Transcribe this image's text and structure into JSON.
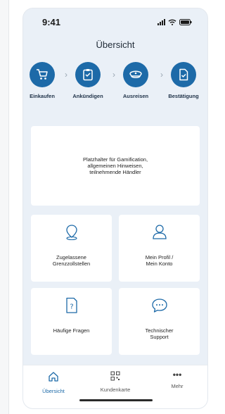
{
  "status_bar": {
    "time": "9:41"
  },
  "page": {
    "title": "Übersicht"
  },
  "steps": [
    {
      "label": "Einkaufen",
      "icon": "shopping-cart-icon"
    },
    {
      "label": "Ankündigen",
      "icon": "clipboard-icon"
    },
    {
      "label": "Ausreisen",
      "icon": "officer-cap-icon"
    },
    {
      "label": "Bestätigung",
      "icon": "document-check-icon"
    }
  ],
  "placeholder": {
    "text": "Platzhalter für Gamification,\nallgemeinen Hinweisen,\nteilnehmende Händler"
  },
  "cards": [
    {
      "label": "Zugelassene\nGrenzzollstellen",
      "icon": "location-pin-icon"
    },
    {
      "label": "Mein Profil /\nMein Konto",
      "icon": "user-icon"
    },
    {
      "label": "Häufige Fragen",
      "icon": "question-document-icon"
    },
    {
      "label": "Technischer\nSupport",
      "icon": "chat-bubble-icon"
    }
  ],
  "tabbar": {
    "items": [
      {
        "label": "Übersicht",
        "icon": "home-icon",
        "active": true
      },
      {
        "label": "Kundenkarte",
        "icon": "qr-code-icon",
        "active": false
      },
      {
        "label": "Mehr",
        "icon": "more-icon",
        "active": false
      }
    ]
  },
  "colors": {
    "accent": "#1d6aa8",
    "background": "#eaf0f7",
    "card": "#ffffff"
  }
}
